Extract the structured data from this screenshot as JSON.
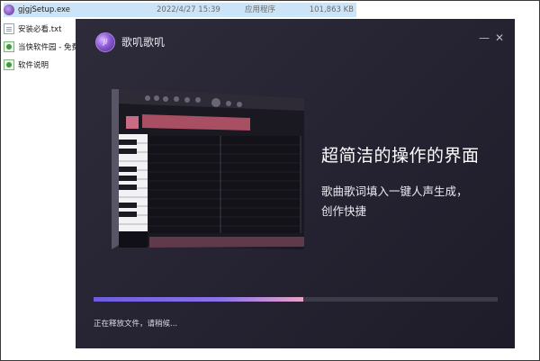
{
  "explorer": {
    "files": [
      {
        "name": "gjgjSetup.exe",
        "date": "2022/4/27 15:39",
        "type": "应用程序",
        "size": "101,863 KB",
        "icon": "exe-icon",
        "selected": true
      },
      {
        "name": "安装必看.txt",
        "icon": "txt-icon"
      },
      {
        "name": "当快软件园 - 免费",
        "icon": "url-icon"
      },
      {
        "name": "软件说明",
        "icon": "url-icon"
      }
    ]
  },
  "installer": {
    "app_name": "歌叽歌叽",
    "logo_text": "ji",
    "minimize_glyph": "—",
    "close_glyph": "✕",
    "headline": "超简洁的操作的界面",
    "subline_1": "歌曲歌词填入一键人声生成，",
    "subline_2": "创作快捷",
    "status_text": "正在释放文件，请稍候...",
    "progress_fraction": 0.52,
    "colors": {
      "accent_start": "#6e5ce0",
      "accent_end": "#e7a3c7",
      "background": "#252331"
    }
  }
}
